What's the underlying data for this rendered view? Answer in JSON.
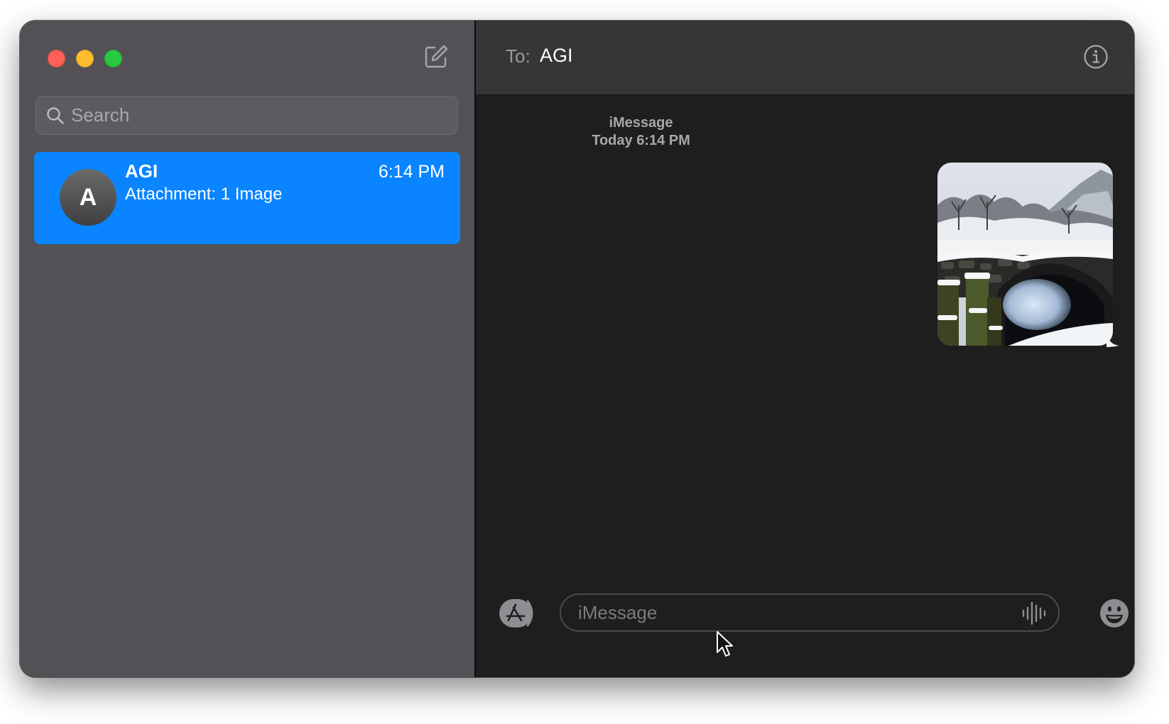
{
  "sidebar": {
    "search": {
      "placeholder": "Search"
    },
    "conversations": [
      {
        "avatar_initial": "A",
        "name": "AGI",
        "time": "6:14 PM",
        "preview": "Attachment: 1 Image",
        "selected": true
      }
    ],
    "compose_icon": "compose-icon"
  },
  "header": {
    "to_label": "To:",
    "recipient": "AGI",
    "info_icon": "info-icon"
  },
  "thread": {
    "service": "iMessage",
    "timestamp": "Today 6:14 PM",
    "messages": [
      {
        "type": "image",
        "subject": "snowy stone bridge"
      }
    ]
  },
  "composer": {
    "placeholder": "iMessage",
    "apps_icon": "app-store-icon",
    "audio_icon": "audio-waveform-icon",
    "emoji_icon": "emoji-icon"
  },
  "colors": {
    "selection": "#0a84ff",
    "sidebar_bg": "#535155",
    "thread_bg": "#1e1e1e",
    "header_bg": "#363538",
    "close": "#ff5f57",
    "minimize": "#febc2e",
    "zoom": "#28c840"
  }
}
